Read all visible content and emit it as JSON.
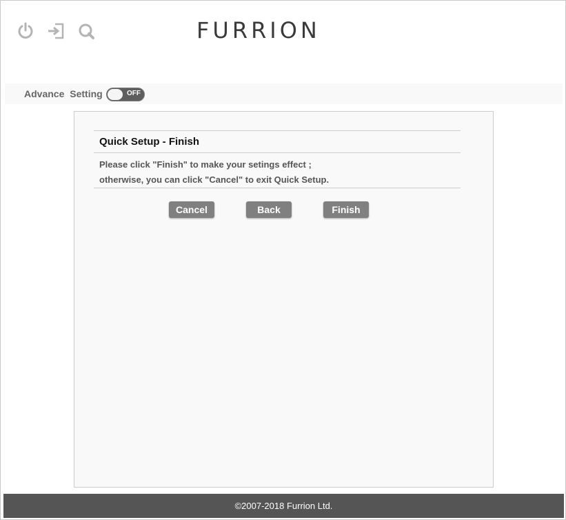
{
  "header": {
    "icons": [
      "power-icon",
      "logout-icon",
      "search-icon"
    ],
    "logo_text": "FURRION"
  },
  "advance": {
    "label": "Advance  Setting",
    "toggle_state": "OFF"
  },
  "quick_setup": {
    "title": "Quick Setup - Finish",
    "message_line1": "Please click \"Finish\" to make your setings effect ;",
    "message_line2": "otherwise, you can click \"Cancel\" to exit Quick Setup.",
    "buttons": {
      "cancel": "Cancel",
      "back": "Back",
      "finish": "Finish"
    }
  },
  "footer": {
    "copyright": "©2007-2018 Furrion Ltd."
  },
  "colors": {
    "button": "#808080",
    "footer": "#555555",
    "icon": "#b4b4b4"
  }
}
